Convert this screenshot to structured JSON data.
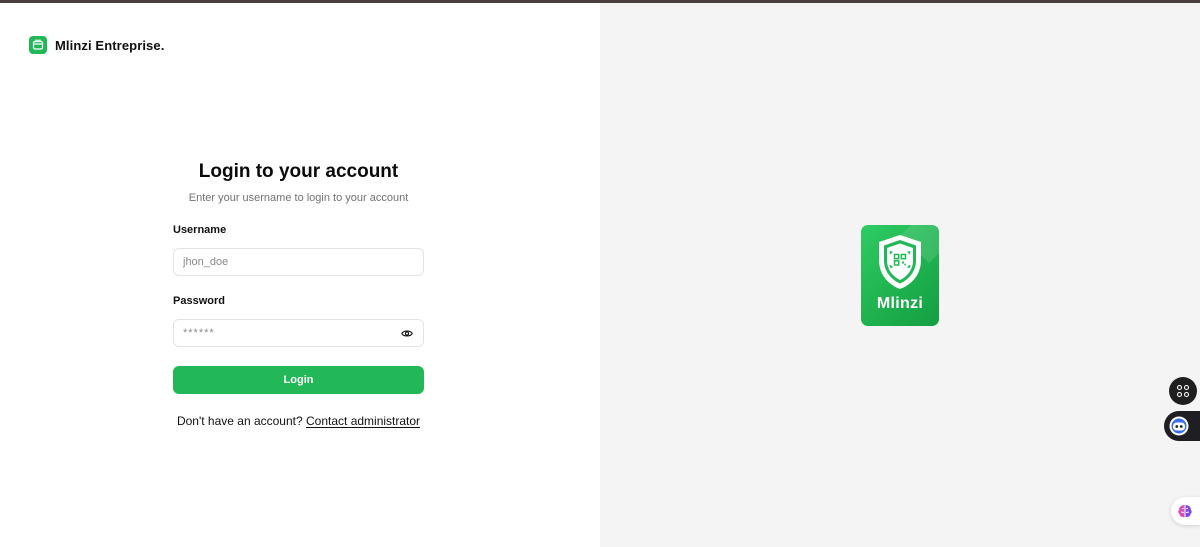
{
  "brand": {
    "name": "Mlinzi Entreprise.",
    "icon": "wallet-icon",
    "color": "#22b857"
  },
  "login": {
    "title": "Login to your account",
    "subtitle": "Enter your username to login to your account",
    "username_label": "Username",
    "username_placeholder": "jhon_doe",
    "password_label": "Password",
    "password_placeholder": "******",
    "password_toggle_icon": "eye-icon",
    "submit_label": "Login",
    "footer_text": "Don't have an account?",
    "footer_link": "Contact administrator"
  },
  "hero": {
    "logo_text": "Mlinzi",
    "logo_icon": "shield-qr-icon"
  },
  "floating": {
    "apps_icon": "apps-icon",
    "assistant_icon": "bot-icon",
    "brain_icon": "brain-icon"
  },
  "colors": {
    "accent": "#22b857",
    "panel_bg": "#f4f4f4",
    "muted_text": "#737373"
  }
}
